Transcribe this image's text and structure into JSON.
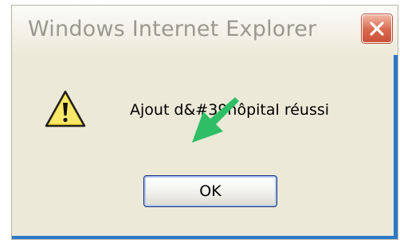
{
  "dialog": {
    "title": "Windows Internet Explorer",
    "message": "Ajout d&#39hôpital réussi",
    "ok_label": "OK"
  },
  "icons": {
    "warning": "warning-icon",
    "close": "close-icon",
    "annotation": "green-arrow-icon"
  },
  "colors": {
    "dialog_background": "#ece9d8",
    "close_button": "#d9674d",
    "arrow": "#2fbe66",
    "frame_edge": "#2b7ac7"
  }
}
